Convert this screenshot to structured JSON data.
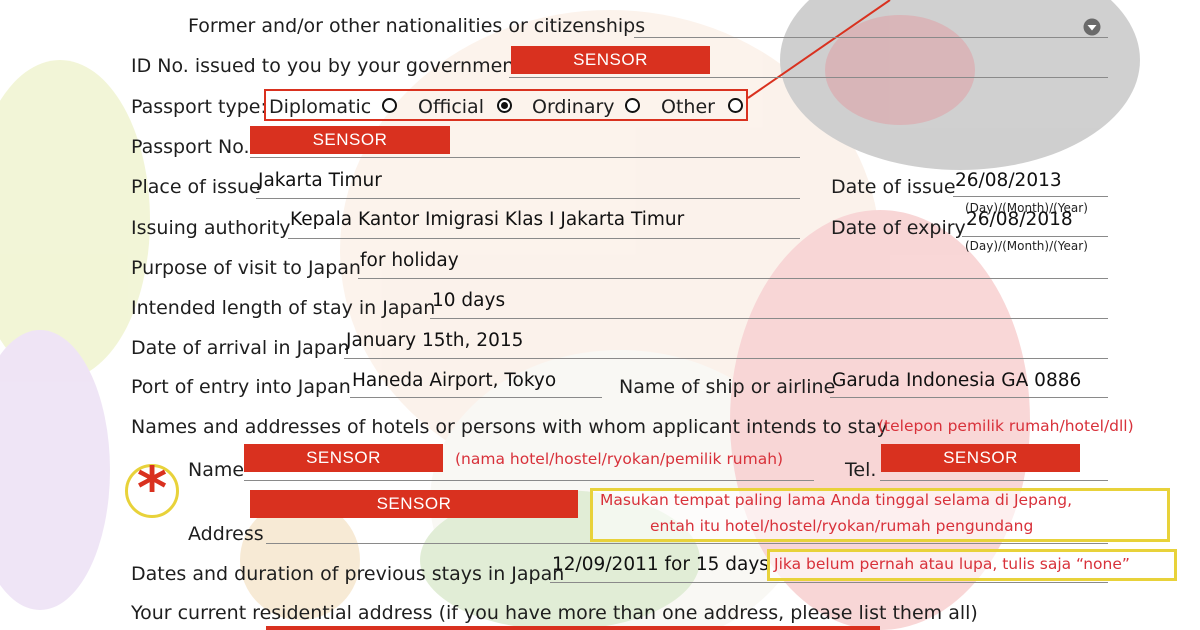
{
  "form": {
    "former_nationalities_label": "Former and/or other nationalities or citizenships",
    "id_no_label": "ID No. issued to you by your government",
    "passport_type_label": "Passport type:",
    "passport_types": [
      {
        "label": "Diplomatic",
        "checked": false
      },
      {
        "label": "Official",
        "checked": true
      },
      {
        "label": "Ordinary",
        "checked": false
      },
      {
        "label": "Other",
        "checked": false
      }
    ],
    "passport_no_label": "Passport No.",
    "place_of_issue_label": "Place of issue",
    "place_of_issue_value": "Jakarta Timur",
    "date_of_issue_label": "Date of issue",
    "date_of_issue_value": "26/08/2013",
    "date_format_hint": "(Day)/(Month)/(Year)",
    "issuing_authority_label": "Issuing authority",
    "issuing_authority_value": "Kepala Kantor Imigrasi Klas I Jakarta Timur",
    "date_of_expiry_label": "Date of expiry",
    "date_of_expiry_value": "26/08/2018",
    "purpose_label": "Purpose of visit to Japan",
    "purpose_value": "for holiday",
    "length_label": "Intended length of stay in Japan",
    "length_value": "10 days",
    "arrival_label": "Date of arrival in Japan",
    "arrival_value": "January 15th, 2015",
    "port_label": "Port of entry into Japan",
    "port_value": "Haneda Airport, Tokyo",
    "ship_label": "Name of ship or airline",
    "ship_value": "Garuda Indonesia GA 0886",
    "hotels_label": "Names and addresses of hotels or persons with whom applicant intends to stay",
    "name_label": "Name",
    "tel_label": "Tel.",
    "address_label": "Address",
    "previous_stays_label": "Dates and duration of previous stays in Japan",
    "previous_stays_value": "12/09/2011 for 15 days",
    "current_address_label": "Your current residential address (if you have more than one address, please list them all)"
  },
  "redaction_text": "SENSOR",
  "annotations": {
    "hotels_note": "(telepon pemilik rumah/hotel/dll)",
    "name_note": "(nama hotel/hostel/ryokan/pemilik rumah)",
    "address_note_line1": "Masukan tempat paling lama Anda tinggal selama di Jepang,",
    "address_note_line2": "entah itu hotel/hostel/ryokan/rumah pengundang",
    "previous_note": "Jika belum pernah atau lupa, tulis saja “none”",
    "asterisk": "*"
  },
  "colors": {
    "redaction": "#d9311f",
    "annotation_red": "#d8313a",
    "highlight_yellow": "#e8d23a",
    "highlight_red_box": "#d9311f"
  }
}
